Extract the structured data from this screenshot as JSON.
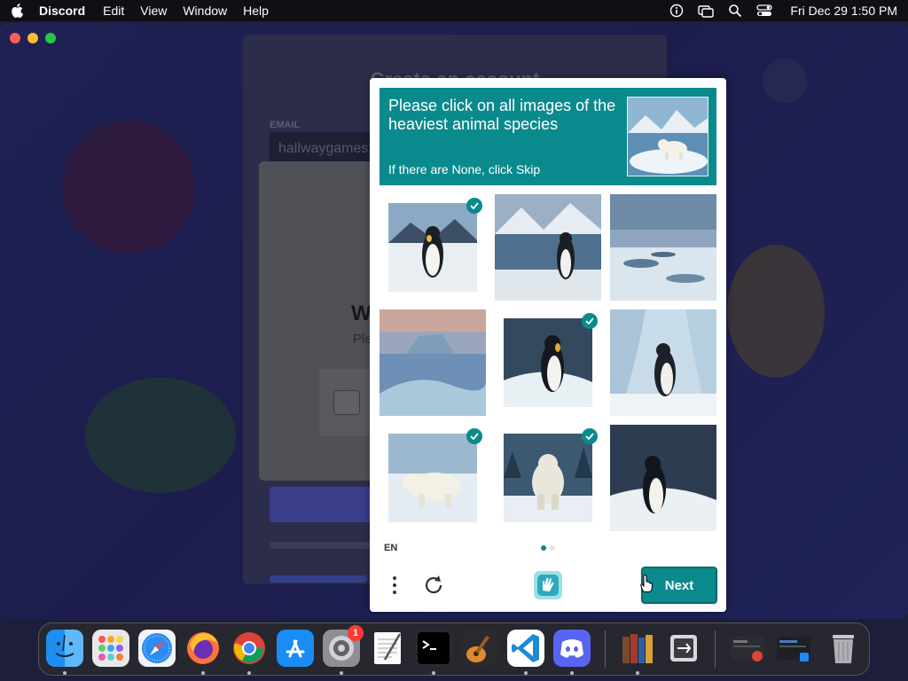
{
  "menubar": {
    "app_name": "Discord",
    "menus": [
      "Edit",
      "View",
      "Window",
      "Help"
    ],
    "clock": "Fri Dec 29  1:50 PM",
    "status_icons": [
      "info-icon",
      "screen-mirror-icon",
      "spotlight-search-icon",
      "control-center-icon"
    ]
  },
  "discord": {
    "register_title": "Create an account",
    "email_label": "EMAIL",
    "email_value": "hallwaygames2",
    "modal_heading_partial": "W",
    "modal_text_partial": "Ple"
  },
  "captcha": {
    "prompt": "Please click on all images of the heaviest animal species",
    "skip_hint": "If there are None, click Skip",
    "accent_color": "#0b8a8e",
    "tiles": [
      {
        "subject": "penguin on ice",
        "selected": true
      },
      {
        "subject": "penguin by water",
        "selected": false
      },
      {
        "subject": "ice field",
        "selected": false
      },
      {
        "subject": "iceberg",
        "selected": false
      },
      {
        "subject": "penguin",
        "selected": true
      },
      {
        "subject": "penguin in ice cave",
        "selected": false
      },
      {
        "subject": "polar bear",
        "selected": true
      },
      {
        "subject": "polar bear",
        "selected": true
      },
      {
        "subject": "penguin",
        "selected": false
      }
    ],
    "language": "EN",
    "page_indicator": {
      "current": 1,
      "total": 2
    },
    "next_label": "Next"
  },
  "dock": {
    "apps": [
      "finder-icon",
      "launchpad-icon",
      "safari-icon",
      "firefox-icon",
      "chrome-icon",
      "app-store-icon",
      "system-settings-icon",
      "textedit-icon",
      "terminal-icon",
      "garageband-icon",
      "vscode-icon",
      "discord-icon",
      "calibre-icon",
      "migration-assistant-icon",
      "recent-window-icon",
      "recent-window-icon",
      "trash-icon"
    ],
    "settings_badge": "1"
  }
}
